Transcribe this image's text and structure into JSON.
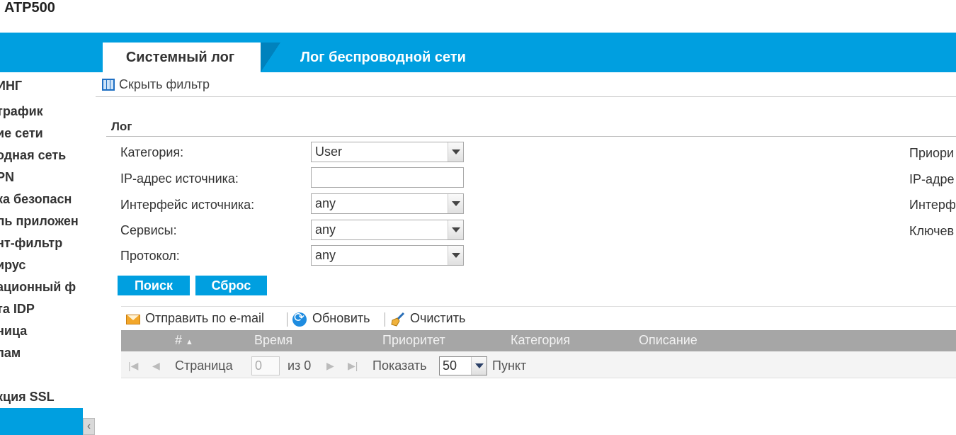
{
  "brand": "ATP500",
  "tabs": [
    {
      "label": "Системный лог",
      "active": true
    },
    {
      "label": "Лог беспроводной сети",
      "active": false
    }
  ],
  "sidebar": {
    "items": [
      "ИНГ",
      "трафик",
      "ие сети",
      "одная сеть",
      "PN",
      "ка безопасн",
      "ль приложен",
      "нт-фильтр",
      "ирус",
      "ационный ф",
      "та IDP",
      "ница",
      "пам",
      "кция SSL"
    ],
    "collapse_glyph": "‹"
  },
  "filter_bar": {
    "label": "Скрыть фильтр"
  },
  "section": {
    "title": "Лог"
  },
  "form": {
    "category": {
      "label": "Категория:",
      "value": "User"
    },
    "source_ip": {
      "label": "IP-адрес источника:",
      "value": ""
    },
    "source_interface": {
      "label": "Интерфейс источника:",
      "value": "any"
    },
    "services": {
      "label": "Сервисы:",
      "value": "any"
    },
    "protocol": {
      "label": "Протокол:",
      "value": "any"
    }
  },
  "right_labels": [
    "Приори",
    "IP-адре",
    "Интерф",
    "Ключев"
  ],
  "buttons": {
    "search": "Поиск",
    "reset": "Сброс"
  },
  "grid_toolbar": {
    "email": "Отправить по e-mail",
    "refresh": "Обновить",
    "clear": "Очистить"
  },
  "grid_columns": [
    "#",
    "Время",
    "Приоритет",
    "Категория",
    "Описание"
  ],
  "sort_indicator": "▲",
  "pager": {
    "page_label": "Страница",
    "page_value": "0",
    "of_label": "из 0",
    "show_label": "Показать",
    "page_size": "50",
    "items_label": "Пункт"
  }
}
